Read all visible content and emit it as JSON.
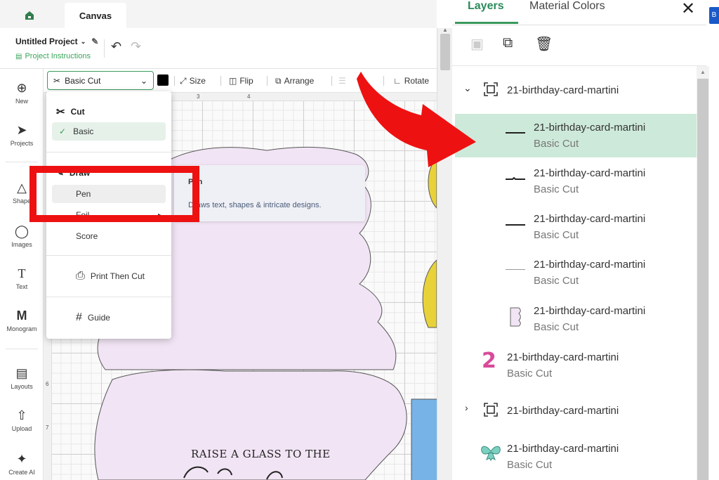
{
  "tabs": {
    "canvas": "Canvas"
  },
  "project": {
    "name": "Untitled Project",
    "instructions": "Project Instructions"
  },
  "left_toolbar": [
    {
      "label": "New",
      "icon": "plus-circle-icon"
    },
    {
      "label": "Projects",
      "icon": "rocket-icon"
    },
    {
      "label": "Shape",
      "icon": "shapes-icon"
    },
    {
      "label": "Images",
      "icon": "lightbulb-icon"
    },
    {
      "label": "Text",
      "icon": "text-icon"
    },
    {
      "label": "Monogram",
      "icon": "monogram-icon"
    },
    {
      "label": "Layouts",
      "icon": "shirt-icon"
    },
    {
      "label": "Upload",
      "icon": "upload-icon"
    },
    {
      "label": "Create AI",
      "icon": "sparkle-icon"
    }
  ],
  "edit_toolbar": {
    "operation": "Basic Cut",
    "size": "Size",
    "flip": "Flip",
    "arrange": "Arrange",
    "rotate": "Rotate",
    "swatch_color": "#000000"
  },
  "ruler": {
    "top": [
      "3",
      "4"
    ],
    "left": [
      "6",
      "7"
    ]
  },
  "dropdown": {
    "cut_heading": "Cut",
    "basic": "Basic",
    "draw_heading": "Draw",
    "pen": "Pen",
    "foil": "Foil",
    "score": "Score",
    "print_then_cut": "Print Then Cut",
    "guide": "Guide"
  },
  "tooltip": {
    "title": "Pen",
    "description": "Draws text, shapes & intricate designs."
  },
  "canvas_text": {
    "line1": "RAISE A GLASS TO THE"
  },
  "right_panel": {
    "tabs": [
      "Layers",
      "Material Colors"
    ],
    "layers": [
      {
        "name": "21-birthday-card-martini",
        "op": ""
      },
      {
        "name": "21-birthday-card-martini",
        "op": "Basic Cut"
      },
      {
        "name": "21-birthday-card-martini",
        "op": "Basic Cut"
      },
      {
        "name": "21-birthday-card-martini",
        "op": "Basic Cut"
      },
      {
        "name": "21-birthday-card-martini",
        "op": "Basic Cut"
      },
      {
        "name": "21-birthday-card-martini",
        "op": "Basic Cut"
      },
      {
        "name": "21-birthday-card-martini",
        "op": "Basic Cut"
      },
      {
        "name": "21-birthday-card-martini",
        "op": ""
      },
      {
        "name": "21-birthday-card-martini",
        "op": "Basic Cut"
      }
    ]
  },
  "colors": {
    "accent": "#3a9a5c",
    "selection": "#cde9d9",
    "annotation_red": "#ee1111",
    "card_fill": "#f1e4f4"
  }
}
